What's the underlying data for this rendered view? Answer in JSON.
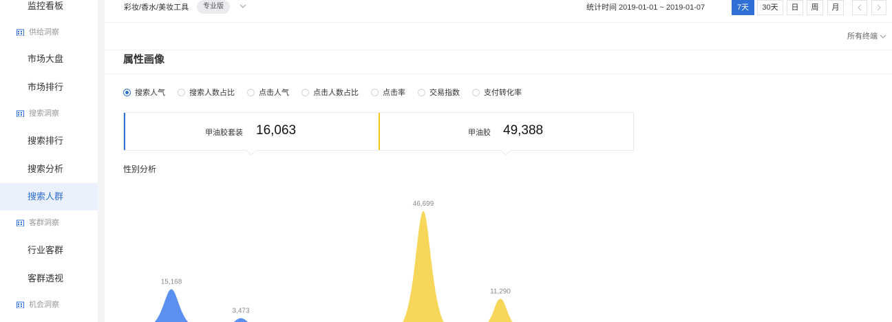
{
  "sidebar": {
    "items": [
      {
        "label": "监控看板"
      },
      {
        "group": "供给洞察"
      },
      {
        "label": "市场大盘"
      },
      {
        "label": "市场排行"
      },
      {
        "group": "搜索洞察"
      },
      {
        "label": "搜索排行"
      },
      {
        "label": "搜索分析"
      },
      {
        "label": "搜索人群",
        "active": true
      },
      {
        "group": "客群洞察"
      },
      {
        "label": "行业客群"
      },
      {
        "label": "客群透视"
      },
      {
        "group": "机会洞察"
      }
    ]
  },
  "header": {
    "breadcrumb": "彩妆/香水/美妆工具",
    "edition": "专业版",
    "date_label": "统计时间 2019-01-01 ~ 2019-01-07",
    "periods": [
      "7天",
      "30天",
      "日",
      "周",
      "月"
    ],
    "active_period": "7天",
    "terminal": "所有终端"
  },
  "card": {
    "title": "属性画像",
    "metrics": [
      "搜索人气",
      "搜索人数占比",
      "点击人气",
      "点击人数占比",
      "点击率",
      "交易指数",
      "支付转化率"
    ],
    "selected_metric": "搜索人气",
    "compare": [
      {
        "label": "甲油胶套装",
        "value": "16,063",
        "color": "#2f6fd6"
      },
      {
        "label": "甲油胶",
        "value": "49,388",
        "color": "#f5c518"
      }
    ],
    "section": "性别分析"
  },
  "chart_data": {
    "type": "area",
    "series": [
      {
        "name": "甲油胶套装",
        "values": [
          15168,
          3473
        ],
        "color": "#5b8ff0"
      },
      {
        "name": "甲油胶",
        "values": [
          46699,
          11290
        ],
        "color": "#f7d75a"
      }
    ],
    "data_labels": [
      "15,168",
      "3,473",
      "46,699",
      "11,290"
    ]
  }
}
